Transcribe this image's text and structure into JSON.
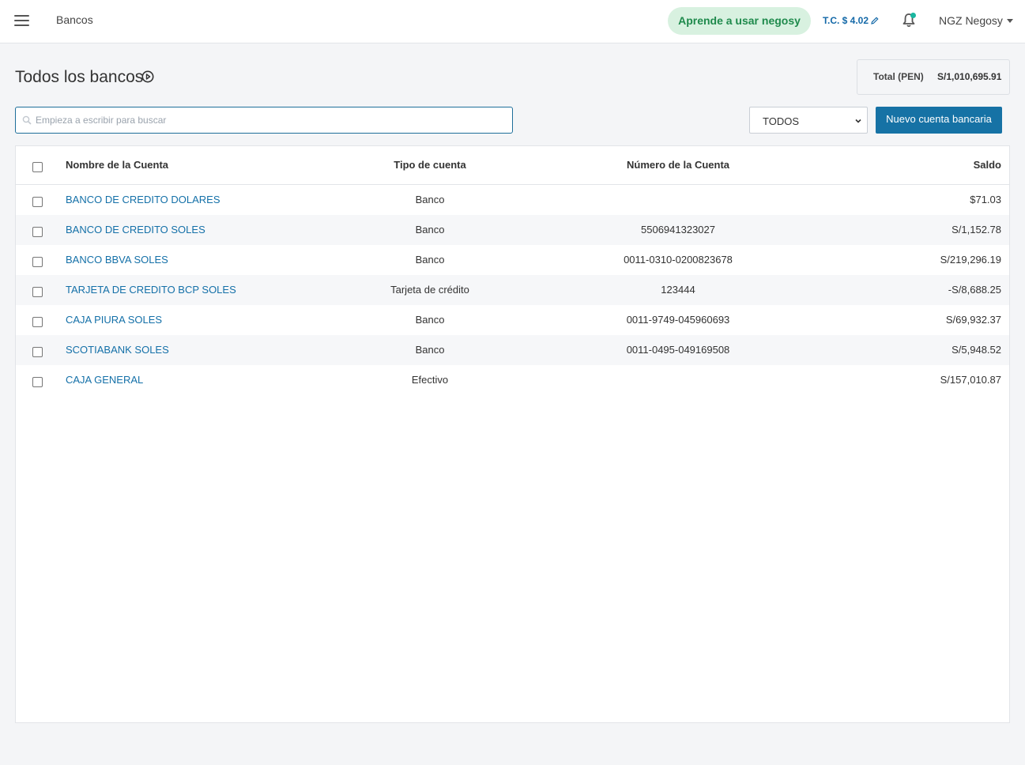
{
  "header": {
    "breadcrumb": "Bancos",
    "learn_button": "Aprende a usar negosy",
    "exchange_rate": "T.C. $ 4.02",
    "user_name": "NGZ Negosy"
  },
  "page": {
    "title": "Todos los bancos",
    "total_label": "Total (PEN)",
    "total_value": "S/1,010,695.91"
  },
  "search": {
    "placeholder": "Empieza a escribir para buscar",
    "value": ""
  },
  "filter": {
    "selected": "TODOS"
  },
  "new_button": "Nuevo cuenta bancaria",
  "table": {
    "columns": {
      "name": "Nombre de la Cuenta",
      "type": "Tipo de cuenta",
      "number": "Número de la Cuenta",
      "balance": "Saldo"
    },
    "rows": [
      {
        "name": "BANCO DE CREDITO DOLARES",
        "type": "Banco",
        "number": "",
        "balance": "$71.03"
      },
      {
        "name": "BANCO DE CREDITO SOLES",
        "type": "Banco",
        "number": "5506941323027",
        "balance": "S/1,152.78"
      },
      {
        "name": "BANCO BBVA SOLES",
        "type": "Banco",
        "number": "0011-0310-0200823678",
        "balance": "S/219,296.19"
      },
      {
        "name": "TARJETA DE CREDITO BCP SOLES",
        "type": "Tarjeta de crédito",
        "number": "123444",
        "balance": "-S/8,688.25"
      },
      {
        "name": "CAJA PIURA SOLES",
        "type": "Banco",
        "number": "0011-9749-045960693",
        "balance": "S/69,932.37"
      },
      {
        "name": "SCOTIABANK SOLES",
        "type": "Banco",
        "number": "0011-0495-049169508",
        "balance": "S/5,948.52"
      },
      {
        "name": "CAJA GENERAL",
        "type": "Efectivo",
        "number": "",
        "balance": "S/157,010.87"
      }
    ]
  },
  "colors": {
    "primary": "#1672a5",
    "link": "#1470a8",
    "learn_bg": "#d8f1e0",
    "learn_text": "#1f8a4c",
    "notification_dot": "#19b7a0"
  },
  "icons": [
    "menu-icon",
    "pencil-icon",
    "bell-icon",
    "chevron-down-icon",
    "play-circle-icon",
    "search-icon"
  ]
}
